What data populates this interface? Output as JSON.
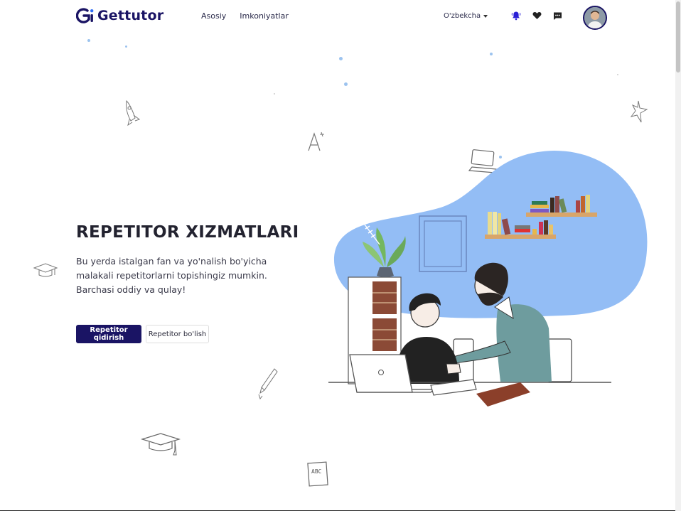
{
  "brand": {
    "name": "Gettutor",
    "color": "#1a1464",
    "accent": "#2e6df6"
  },
  "nav": {
    "items": [
      {
        "label": "Asosiy"
      },
      {
        "label": "Imkoniyatlar"
      }
    ]
  },
  "language": {
    "selected": "O'zbekcha"
  },
  "header_icons": [
    "notification-bell-icon",
    "heart-icon",
    "chat-icon"
  ],
  "hero": {
    "title": "REPETITOR XIZMATLARI",
    "subtitle": "Bu yerda istalgan fan va yo'nalish bo'yicha malakali repetitorlarni topishingiz mumkin. Barchasi oddiy va qulay!",
    "primary_button": "Repetitor qidirish",
    "secondary_button": "Repetitor bo'lish"
  },
  "illustration": {
    "blob_color": "#93bdf5",
    "doodle_abc": "ABC"
  },
  "colors": {
    "primary": "#1a1464",
    "text": "#232330",
    "blob": "#93bdf5"
  }
}
